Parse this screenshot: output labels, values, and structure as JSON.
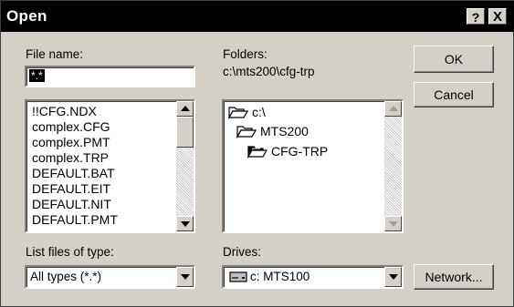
{
  "title": "Open",
  "title_buttons": {
    "help": "?",
    "close": "X"
  },
  "filename": {
    "label": "File name:",
    "label_accel": "n",
    "value": "*.*"
  },
  "file_list": {
    "items": [
      "!!CFG.NDX",
      "complex.CFG",
      "complex.PMT",
      "complex.TRP",
      "DEFAULT.BAT",
      "DEFAULT.EIT",
      "DEFAULT.NIT",
      "DEFAULT.PMT"
    ]
  },
  "folders": {
    "label": "Folders:",
    "label_accel": "F",
    "current_path": "c:\\mts200\\cfg-trp",
    "tree": [
      {
        "name": "c:\\",
        "icon": "open-folder-icon"
      },
      {
        "name": "MTS200",
        "icon": "open-folder-icon"
      },
      {
        "name": "CFG-TRP",
        "icon": "open-folder-selected-icon"
      }
    ]
  },
  "file_type": {
    "label": "List files of type:",
    "label_accel": "t",
    "value": "All types (*.*)"
  },
  "drives": {
    "label": "Drives:",
    "label_accel": "v",
    "value": "c: MTS100",
    "icon": "hard-drive-icon"
  },
  "buttons": {
    "ok": "OK",
    "cancel": "Cancel",
    "network": "Network...",
    "network_accel": "w"
  }
}
